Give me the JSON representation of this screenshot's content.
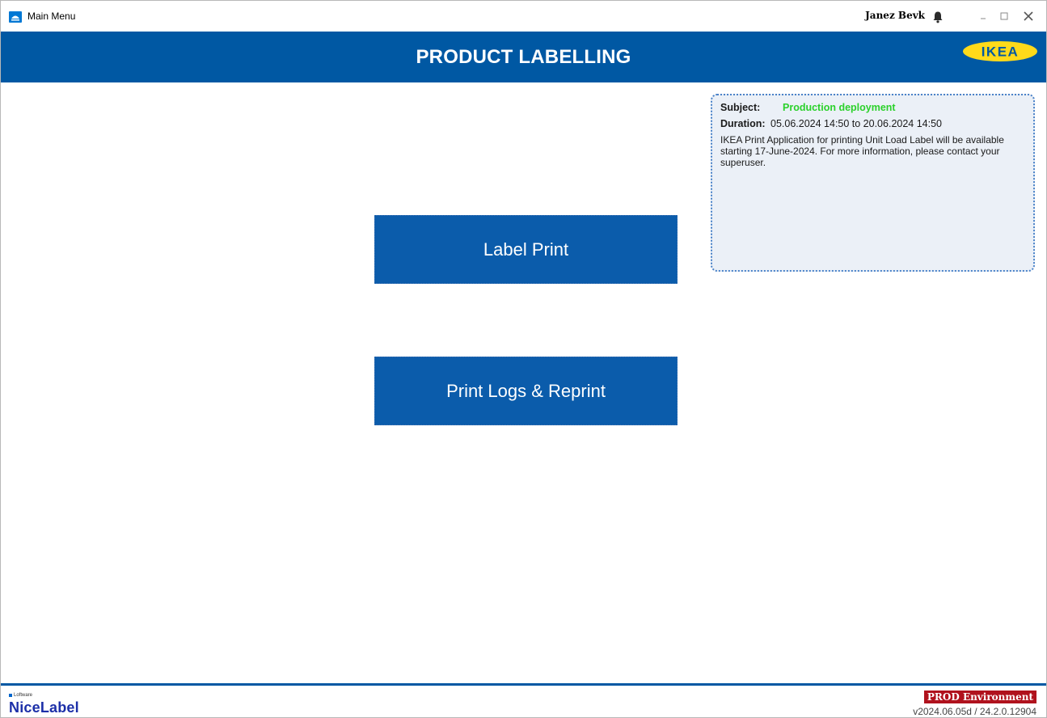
{
  "window": {
    "title": "Main Menu",
    "user": "Janez Bevk",
    "icons": {
      "app": "app-icon",
      "bell": "bell-icon",
      "minimize": "minimize-icon",
      "maximize": "maximize-icon",
      "close": "close-icon"
    }
  },
  "header": {
    "title": "PRODUCT LABELLING",
    "logo_text": "IKEA",
    "color": "#0058a3"
  },
  "main": {
    "buttons": [
      {
        "label": "Label Print"
      },
      {
        "label": "Print Logs & Reprint"
      }
    ],
    "button_color": "#0b5cab"
  },
  "notice": {
    "subject_label": "Subject:",
    "subject_value": "Production deployment",
    "subject_color": "#2bd12b",
    "duration_label": "Duration:",
    "duration_value": "05.06.2024 14:50 to 20.06.2024 14:50",
    "body": "IKEA Print Application for printing Unit Load Label will be available starting 17-June-2024. For more information, please contact your superuser."
  },
  "footer": {
    "brand_small": "Loftware",
    "brand_main": "NiceLabel",
    "environment": "PROD Environment",
    "environment_color": "#b0121d",
    "version": "v2024.06.05d / 24.2.0.12904"
  }
}
